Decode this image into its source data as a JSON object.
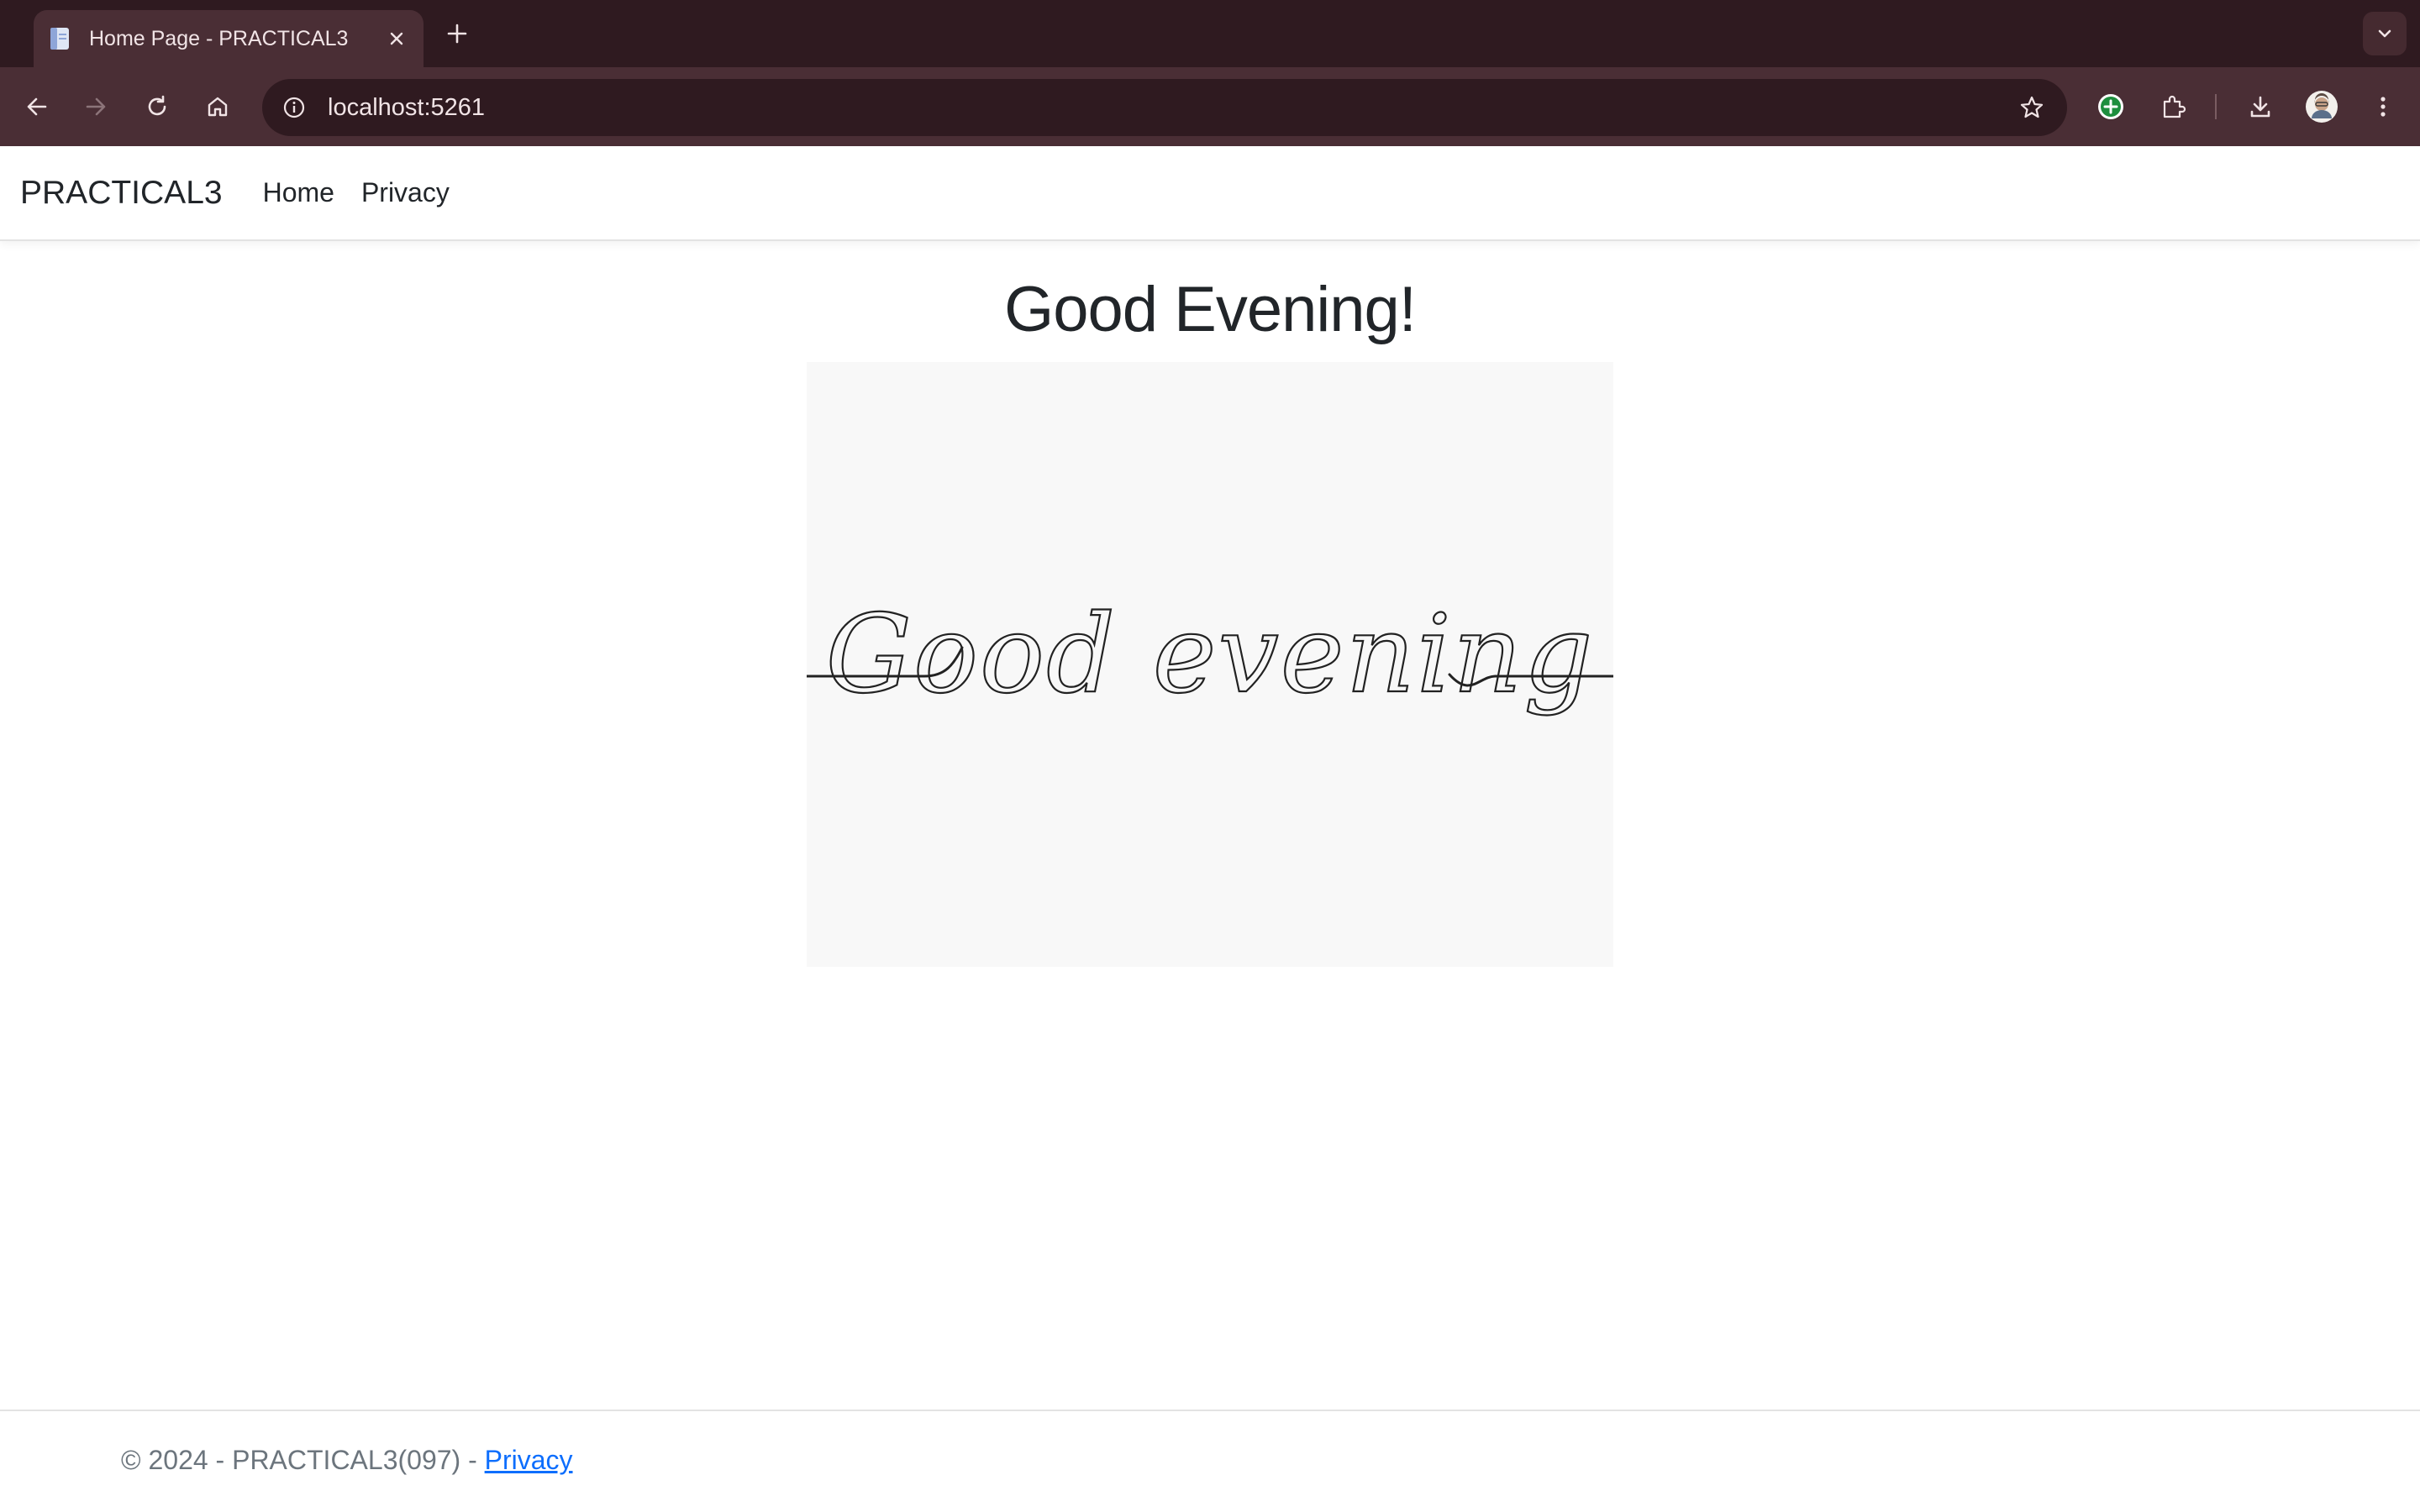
{
  "browser": {
    "tab": {
      "title": "Home Page - PRACTICAL3",
      "favicon": "document-icon"
    },
    "address_bar": {
      "url": "localhost:5261"
    },
    "theme": {
      "tabstrip_bg": "#2f1a20",
      "toolbar_bg": "#4a2e35"
    }
  },
  "navbar": {
    "brand": "PRACTICAL3",
    "links": [
      "Home",
      "Privacy"
    ]
  },
  "main": {
    "heading": "Good Evening!",
    "image": {
      "script_text": "Good evening",
      "background": "#f8f8f8"
    }
  },
  "footer": {
    "text": "© 2024 - PRACTICAL3(097) - ",
    "link": "Privacy",
    "link_color": "#0d6efd"
  }
}
